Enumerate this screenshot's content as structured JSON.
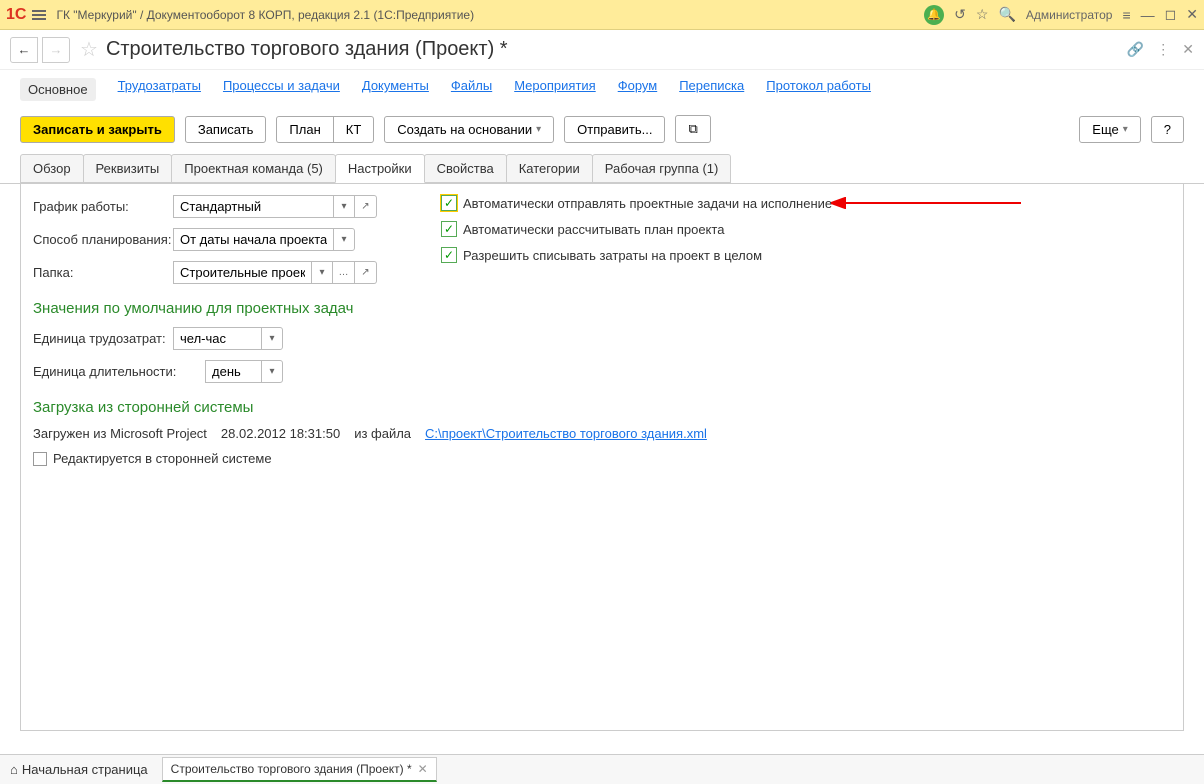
{
  "titlebar": {
    "logo": "1C",
    "title": "ГК \"Меркурий\" / Документооборот 8 КОРП, редакция 2.1  (1С:Предприятие)",
    "user": "Администратор"
  },
  "nav": {
    "page_title": "Строительство торгового здания (Проект) *"
  },
  "sections": {
    "main": "Основное",
    "labor": "Трудозатраты",
    "processes": "Процессы и задачи",
    "documents": "Документы",
    "files": "Файлы",
    "events": "Мероприятия",
    "forum": "Форум",
    "correspondence": "Переписка",
    "protocol": "Протокол работы"
  },
  "toolbar": {
    "save_close": "Записать и закрыть",
    "save": "Записать",
    "plan": "План",
    "kt": "КТ",
    "create_based": "Создать на основании",
    "send": "Отправить...",
    "more": "Еще",
    "help": "?"
  },
  "tabs": {
    "overview": "Обзор",
    "requisites": "Реквизиты",
    "team": "Проектная команда (5)",
    "settings": "Настройки",
    "properties": "Свойства",
    "categories": "Категории",
    "workgroup": "Рабочая группа (1)"
  },
  "form": {
    "schedule_label": "График работы:",
    "schedule_value": "Стандартный",
    "planning_label": "Способ планирования:",
    "planning_value": "От даты начала проекта",
    "folder_label": "Папка:",
    "folder_value": "Строительные проекть"
  },
  "checkboxes": {
    "auto_send": "Автоматически отправлять проектные задачи на исполнение",
    "auto_calc": "Автоматически рассчитывать план проекта",
    "allow_write": "Разрешить списывать затраты на проект в целом"
  },
  "defaults": {
    "heading": "Значения по умолчанию для проектных задач",
    "labor_unit_label": "Единица трудозатрат:",
    "labor_unit_value": "чел-час",
    "duration_unit_label": "Единица длительности:",
    "duration_unit_value": "день"
  },
  "external": {
    "heading": "Загрузка из сторонней системы",
    "loaded_from": "Загружен из Microsoft Project",
    "date": "28.02.2012 18:31:50",
    "from_file": "из файла",
    "file_link": "C:\\проект\\Строительство торгового здания.xml",
    "edit_external": "Редактируется в сторонней системе"
  },
  "bottom": {
    "home": "Начальная страница",
    "tab": "Строительство торгового здания (Проект) *"
  }
}
